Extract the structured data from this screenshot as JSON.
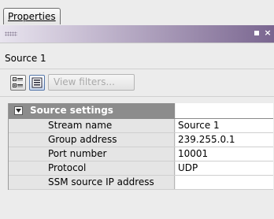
{
  "tabs": [
    {
      "label": "Properties"
    }
  ],
  "panel": {
    "title": "Source 1"
  },
  "titlebar": {
    "restore_icon": "restore-icon",
    "close_glyph": "×"
  },
  "toolbar": {
    "categorized_icon": "categorized-view-icon",
    "list_icon": "list-view-icon",
    "filter_label": "View filters..."
  },
  "properties": {
    "section": {
      "label": "Source settings",
      "expanded": true
    },
    "rows": [
      {
        "name": "Stream name",
        "value": "Source 1"
      },
      {
        "name": "Group address",
        "value": "239.255.0.1"
      },
      {
        "name": "Port number",
        "value": "10001"
      },
      {
        "name": "Protocol",
        "value": "UDP"
      },
      {
        "name": "SSM source IP address",
        "value": ""
      }
    ]
  },
  "colors": {
    "titlebar_gradient_end": "#7a6690",
    "section_header": "#8c8c8c",
    "name_cell": "#e5e5e5"
  }
}
